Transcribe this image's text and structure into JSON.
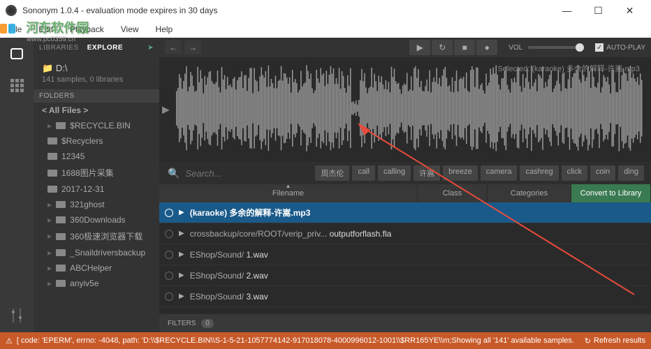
{
  "window": {
    "title": "Sononym 1.0.4 - evaluation mode expires in 30 days"
  },
  "menu": {
    "items": [
      "File",
      "Edit",
      "Playback",
      "View",
      "Help"
    ]
  },
  "watermark": {
    "text": "河东软件园",
    "sub": "www.pc0359.cn"
  },
  "sidebar": {
    "tabs": {
      "libraries": "LIBRARIES",
      "explore": "EXPLORE"
    },
    "drive": {
      "path": "D:\\",
      "count": "141 samples, 0 libraries"
    },
    "folders_header": "FOLDERS",
    "all_files": "< All Files >",
    "folders": [
      "$RECYCLE.BIN",
      "$Recyclers",
      "12345",
      "1688图片采集",
      "2017-12-31",
      "321ghost",
      "360Downloads",
      "360极速浏览器下载",
      "_Snaildriversbackup",
      "ABCHelper",
      "anyiv5e"
    ]
  },
  "toolbar": {
    "vol_label": "VOL",
    "autoplay_label": "AUTO-PLAY"
  },
  "waveform": {
    "selected_label": "Selected: (karaoke) 多余的解释-许嵩.mp3"
  },
  "search": {
    "placeholder": "Search...",
    "tags": [
      "周杰伦",
      "call",
      "calling",
      "许嵩",
      "breeze",
      "camera",
      "cashreg",
      "click",
      "coin",
      "ding"
    ]
  },
  "table": {
    "headers": {
      "filename": "Filename",
      "class": "Class",
      "categories": "Categories",
      "convert": "Convert to Library"
    },
    "rows": [
      {
        "prefix": "",
        "name": "(karaoke) 多余的解释-许嵩.mp3",
        "selected": true
      },
      {
        "prefix": "crossbackup/core/ROOT/verip_priv...",
        "name": "outputforflash.fla",
        "selected": false
      },
      {
        "prefix": "EShop/Sound/",
        "name": "1.wav",
        "selected": false
      },
      {
        "prefix": "EShop/Sound/",
        "name": "2.wav",
        "selected": false
      },
      {
        "prefix": "EShop/Sound/",
        "name": "3.wav",
        "selected": false
      }
    ]
  },
  "filters": {
    "label": "FILTERS",
    "count": "0"
  },
  "statusbar": {
    "message": "[ code: 'EPERM', errno: -4048, path: 'D:\\\\$RECYCLE.BIN\\\\S-1-5-21-1057774142-917018078-4000996012-1001\\\\$RR165YE\\\\m;Showing all '141' available samples.",
    "refresh": "Refresh results"
  }
}
